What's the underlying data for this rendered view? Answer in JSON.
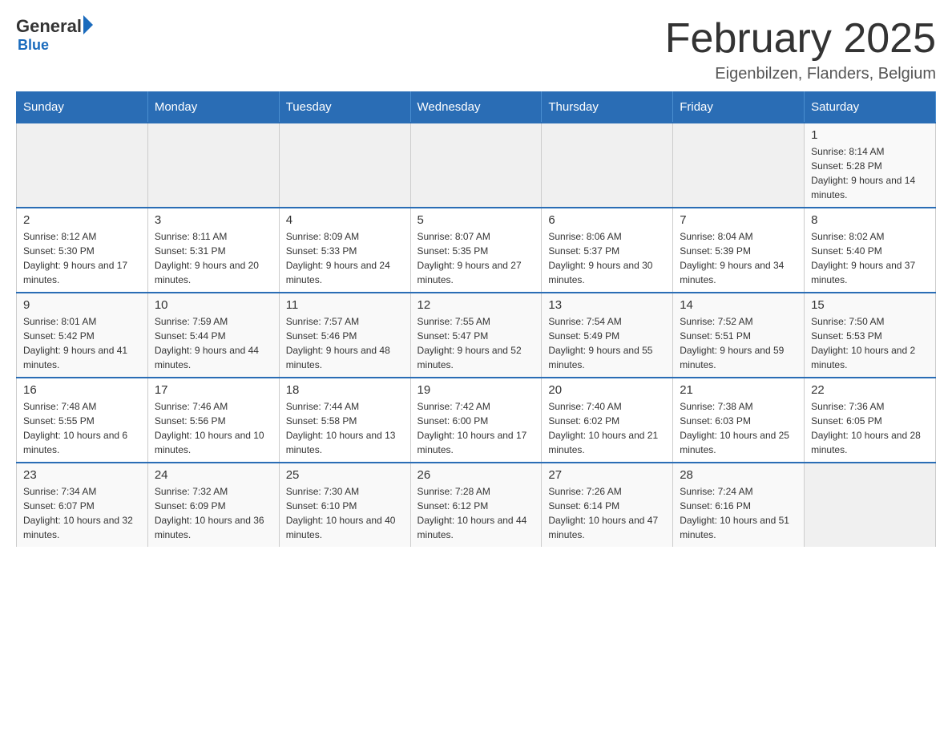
{
  "header": {
    "logo_general": "General",
    "logo_blue": "Blue",
    "month_title": "February 2025",
    "location": "Eigenbilzen, Flanders, Belgium"
  },
  "weekdays": [
    "Sunday",
    "Monday",
    "Tuesday",
    "Wednesday",
    "Thursday",
    "Friday",
    "Saturday"
  ],
  "weeks": [
    [
      {
        "day": "",
        "info": ""
      },
      {
        "day": "",
        "info": ""
      },
      {
        "day": "",
        "info": ""
      },
      {
        "day": "",
        "info": ""
      },
      {
        "day": "",
        "info": ""
      },
      {
        "day": "",
        "info": ""
      },
      {
        "day": "1",
        "info": "Sunrise: 8:14 AM\nSunset: 5:28 PM\nDaylight: 9 hours and 14 minutes."
      }
    ],
    [
      {
        "day": "2",
        "info": "Sunrise: 8:12 AM\nSunset: 5:30 PM\nDaylight: 9 hours and 17 minutes."
      },
      {
        "day": "3",
        "info": "Sunrise: 8:11 AM\nSunset: 5:31 PM\nDaylight: 9 hours and 20 minutes."
      },
      {
        "day": "4",
        "info": "Sunrise: 8:09 AM\nSunset: 5:33 PM\nDaylight: 9 hours and 24 minutes."
      },
      {
        "day": "5",
        "info": "Sunrise: 8:07 AM\nSunset: 5:35 PM\nDaylight: 9 hours and 27 minutes."
      },
      {
        "day": "6",
        "info": "Sunrise: 8:06 AM\nSunset: 5:37 PM\nDaylight: 9 hours and 30 minutes."
      },
      {
        "day": "7",
        "info": "Sunrise: 8:04 AM\nSunset: 5:39 PM\nDaylight: 9 hours and 34 minutes."
      },
      {
        "day": "8",
        "info": "Sunrise: 8:02 AM\nSunset: 5:40 PM\nDaylight: 9 hours and 37 minutes."
      }
    ],
    [
      {
        "day": "9",
        "info": "Sunrise: 8:01 AM\nSunset: 5:42 PM\nDaylight: 9 hours and 41 minutes."
      },
      {
        "day": "10",
        "info": "Sunrise: 7:59 AM\nSunset: 5:44 PM\nDaylight: 9 hours and 44 minutes."
      },
      {
        "day": "11",
        "info": "Sunrise: 7:57 AM\nSunset: 5:46 PM\nDaylight: 9 hours and 48 minutes."
      },
      {
        "day": "12",
        "info": "Sunrise: 7:55 AM\nSunset: 5:47 PM\nDaylight: 9 hours and 52 minutes."
      },
      {
        "day": "13",
        "info": "Sunrise: 7:54 AM\nSunset: 5:49 PM\nDaylight: 9 hours and 55 minutes."
      },
      {
        "day": "14",
        "info": "Sunrise: 7:52 AM\nSunset: 5:51 PM\nDaylight: 9 hours and 59 minutes."
      },
      {
        "day": "15",
        "info": "Sunrise: 7:50 AM\nSunset: 5:53 PM\nDaylight: 10 hours and 2 minutes."
      }
    ],
    [
      {
        "day": "16",
        "info": "Sunrise: 7:48 AM\nSunset: 5:55 PM\nDaylight: 10 hours and 6 minutes."
      },
      {
        "day": "17",
        "info": "Sunrise: 7:46 AM\nSunset: 5:56 PM\nDaylight: 10 hours and 10 minutes."
      },
      {
        "day": "18",
        "info": "Sunrise: 7:44 AM\nSunset: 5:58 PM\nDaylight: 10 hours and 13 minutes."
      },
      {
        "day": "19",
        "info": "Sunrise: 7:42 AM\nSunset: 6:00 PM\nDaylight: 10 hours and 17 minutes."
      },
      {
        "day": "20",
        "info": "Sunrise: 7:40 AM\nSunset: 6:02 PM\nDaylight: 10 hours and 21 minutes."
      },
      {
        "day": "21",
        "info": "Sunrise: 7:38 AM\nSunset: 6:03 PM\nDaylight: 10 hours and 25 minutes."
      },
      {
        "day": "22",
        "info": "Sunrise: 7:36 AM\nSunset: 6:05 PM\nDaylight: 10 hours and 28 minutes."
      }
    ],
    [
      {
        "day": "23",
        "info": "Sunrise: 7:34 AM\nSunset: 6:07 PM\nDaylight: 10 hours and 32 minutes."
      },
      {
        "day": "24",
        "info": "Sunrise: 7:32 AM\nSunset: 6:09 PM\nDaylight: 10 hours and 36 minutes."
      },
      {
        "day": "25",
        "info": "Sunrise: 7:30 AM\nSunset: 6:10 PM\nDaylight: 10 hours and 40 minutes."
      },
      {
        "day": "26",
        "info": "Sunrise: 7:28 AM\nSunset: 6:12 PM\nDaylight: 10 hours and 44 minutes."
      },
      {
        "day": "27",
        "info": "Sunrise: 7:26 AM\nSunset: 6:14 PM\nDaylight: 10 hours and 47 minutes."
      },
      {
        "day": "28",
        "info": "Sunrise: 7:24 AM\nSunset: 6:16 PM\nDaylight: 10 hours and 51 minutes."
      },
      {
        "day": "",
        "info": ""
      }
    ]
  ]
}
